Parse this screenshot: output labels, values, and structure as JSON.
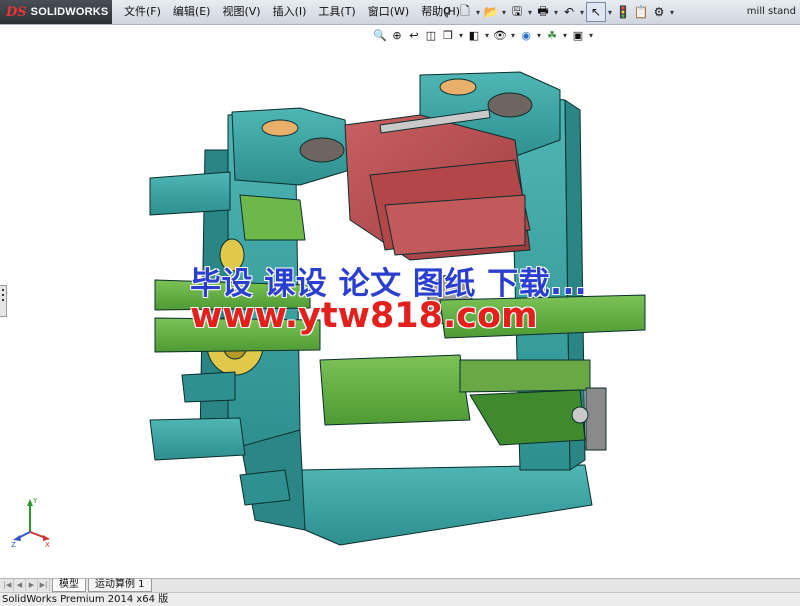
{
  "app": {
    "logo_mark": "DS",
    "logo_text": "SOLIDWORKS",
    "document_title": "mill stand"
  },
  "menu": [
    "文件(F)",
    "编辑(E)",
    "视图(V)",
    "插入(I)",
    "工具(T)",
    "窗口(W)",
    "帮助(H)"
  ],
  "toolbar": {
    "items": [
      {
        "name": "pin-icon",
        "glyph": "⚲"
      },
      {
        "name": "new-document-icon",
        "glyph": "🗋"
      },
      {
        "name": "open-folder-icon",
        "glyph": "📂"
      },
      {
        "name": "save-icon",
        "glyph": "🖫"
      },
      {
        "name": "print-icon",
        "glyph": "🖶"
      },
      {
        "name": "undo-icon",
        "glyph": "↶"
      },
      {
        "name": "select-arrow-icon",
        "glyph": "↖"
      },
      {
        "name": "rebuild-traffic-light-icon",
        "glyph": "🚦"
      },
      {
        "name": "file-properties-icon",
        "glyph": "📋"
      },
      {
        "name": "options-icon",
        "glyph": "⚙"
      }
    ]
  },
  "view_toolbar": {
    "items": [
      {
        "name": "zoom-to-fit-icon",
        "glyph": "🔍"
      },
      {
        "name": "zoom-to-area-icon",
        "glyph": "⊕"
      },
      {
        "name": "previous-view-icon",
        "glyph": "↩"
      },
      {
        "name": "section-view-icon",
        "glyph": "◫"
      },
      {
        "name": "view-orientation-icon",
        "glyph": "❒"
      },
      {
        "name": "display-style-icon",
        "glyph": "◧"
      },
      {
        "name": "hide-show-items-icon",
        "glyph": "👁"
      },
      {
        "name": "edit-appearance-icon",
        "glyph": "◉"
      },
      {
        "name": "apply-scene-icon",
        "glyph": "☘"
      },
      {
        "name": "view-settings-icon",
        "glyph": "▣"
      }
    ]
  },
  "watermark": {
    "line1": "毕设 课设 论文 图纸 下载...",
    "line2": "www.ytw818.com"
  },
  "triad": {
    "x": "X",
    "y": "Y",
    "z": "Z"
  },
  "tabs": [
    "模型",
    "运动算例 1"
  ],
  "tab_nav": [
    "|◀",
    "◀",
    "▶",
    "▶|"
  ],
  "status": "SolidWorks Premium 2014 x64 版",
  "colors": {
    "housing_teal": "#2e9393",
    "housing_teal_light": "#4fb6b6",
    "guide_green": "#5ea83e",
    "carriage_red": "#b4484a",
    "watermark_blue": "#2a3fd0",
    "watermark_red": "#e4201c"
  }
}
